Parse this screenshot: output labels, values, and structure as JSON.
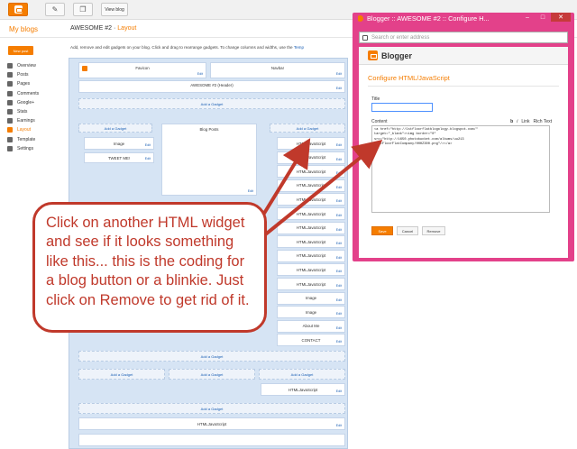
{
  "topbar": {
    "view_blog_label": "View blog"
  },
  "header": {
    "my_blogs": "My blogs",
    "blog_name": "AWESOME #2",
    "separator": "·",
    "section": "Layout"
  },
  "sidebar": {
    "new_post": "New post",
    "items": [
      {
        "label": "Overview",
        "icon": "overview-icon"
      },
      {
        "label": "Posts",
        "icon": "posts-icon"
      },
      {
        "label": "Pages",
        "icon": "pages-icon"
      },
      {
        "label": "Comments",
        "icon": "comments-icon"
      },
      {
        "label": "Google+",
        "icon": "google-plus-icon"
      },
      {
        "label": "Stats",
        "icon": "stats-icon"
      },
      {
        "label": "Earnings",
        "icon": "earnings-icon"
      },
      {
        "label": "Layout",
        "icon": "layout-icon",
        "active": true
      },
      {
        "label": "Template",
        "icon": "template-icon"
      },
      {
        "label": "Settings",
        "icon": "settings-icon"
      }
    ]
  },
  "layout": {
    "description": "Add, remove and edit gadgets on your blog. Click and drag to rearrange gadgets. To change columns and widths, use the",
    "description_link": "Temp",
    "favicon": "Favicon",
    "navbar": "Navbar",
    "edit": "Edit",
    "header": "AWESOME #2 (Header)",
    "add_gadget": "Add a Gadget",
    "image": "Image",
    "tweet_me": "TWEET ME!",
    "blog_posts": "Blog Posts",
    "html_js": "HTMLJavaScript",
    "about_me": "About Me",
    "contact": "CONTACT"
  },
  "popup": {
    "window_title": "Blogger :: AWESOME #2 :: Configure H...",
    "address_placeholder": "Search or enter address",
    "app_name": "Blogger",
    "config_title": "Configure HTML/JavaScript",
    "title_label": "Title",
    "content_label": "Content",
    "toolbar_bold": "b",
    "toolbar_italic": "i",
    "toolbar_link": "Link",
    "rich_text": "Rich Text",
    "content_value": "<a href=\"http://1stfloorflatblogology.blogspot.com/\"\ntarget=\"_blank\"><img border=\"0\"\nsrc=\"http://i650.photobucket.com/albums/uu213\n/1stFloorFlatCompany/HHHZ300.png\"/></a>",
    "save": "Save",
    "cancel": "Cancel",
    "remove": "Remove"
  },
  "callout": {
    "text": "Click on another HTML widget and see if it looks something like this... this is the coding for a blog button or a blinkie. Just click on Remove to get rid of it."
  },
  "colors": {
    "accent": "#f57d00",
    "callout": "#c0392b",
    "popup_frame": "#e3418a",
    "canvas": "#d6e4f4"
  }
}
